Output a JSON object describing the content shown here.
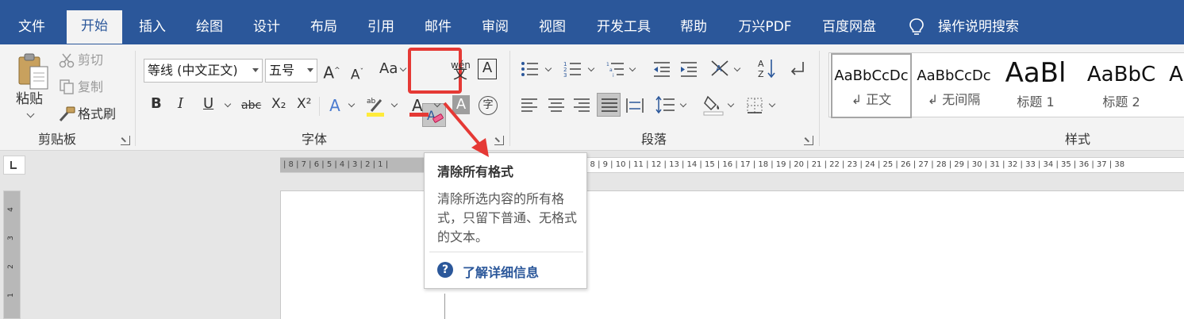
{
  "menu": {
    "tabs": [
      "文件",
      "开始",
      "插入",
      "绘图",
      "设计",
      "布局",
      "引用",
      "邮件",
      "审阅",
      "视图",
      "开发工具",
      "帮助",
      "万兴PDF",
      "百度网盘"
    ],
    "active_tab": "开始",
    "search_label": "操作说明搜索"
  },
  "clipboard": {
    "paste": "粘贴",
    "cut": "剪切",
    "copy": "复制",
    "format_painter": "格式刷",
    "group_label": "剪贴板"
  },
  "font": {
    "font_name": "等线 (中文正文)",
    "font_size": "五号",
    "change_case_label": "Aa",
    "bold": "B",
    "italic": "I",
    "underline": "U",
    "strikethrough": "abc",
    "subscript": "X₂",
    "superscript": "X²",
    "group_label": "字体"
  },
  "paragraph": {
    "group_label": "段落"
  },
  "styles": {
    "group_label": "样式",
    "items": [
      {
        "sample": "AaBbCcDc",
        "name": "↲ 正文"
      },
      {
        "sample": "AaBbCcDc",
        "name": "↲ 无间隔"
      },
      {
        "sample": "AaBl",
        "name": "标题 1"
      },
      {
        "sample": "AaBbC",
        "name": "标题 2"
      },
      {
        "sample": "A",
        "name": ""
      }
    ]
  },
  "ruler": {
    "margin_numbers": "| 8 | 7 | 6 | 5 | 4 | 3 | 2 | 1 |",
    "body_numbers": "| 8 | 9 | 10 | 11 | 12 | 13 | 14 | 15 | 16 | 17 | 18 | 19 | 20 | 21 | 22 | 23 | 24 | 25 | 26 | 27 | 28 | 29 | 30 | 31 | 32 | 33 | 34 | 35 | 36 | 37 | 38",
    "vertical_numbers": [
      "4",
      "3",
      "2",
      "1"
    ]
  },
  "tooltip": {
    "title": "清除所有格式",
    "body": "清除所选内容的所有格式，只留下普通、无格式的文本。",
    "link": "了解详细信息"
  },
  "colors": {
    "accent": "#2b579a",
    "highlight_box": "#e53935",
    "arrow": "#e53935"
  }
}
